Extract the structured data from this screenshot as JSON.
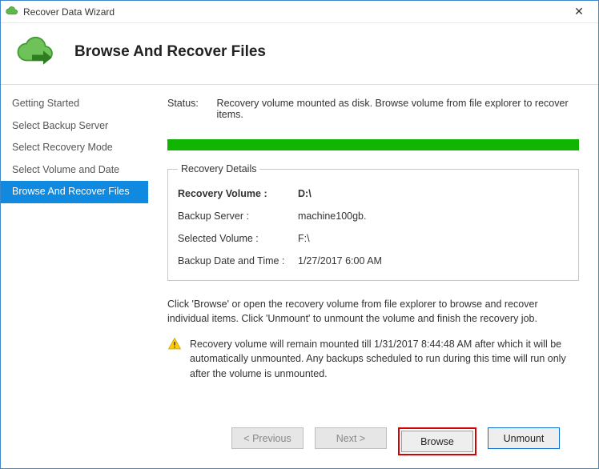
{
  "window": {
    "title": "Recover Data Wizard"
  },
  "header": {
    "title": "Browse And Recover Files"
  },
  "sidebar": {
    "items": [
      {
        "label": "Getting Started"
      },
      {
        "label": "Select Backup Server"
      },
      {
        "label": "Select Recovery Mode"
      },
      {
        "label": "Select Volume and Date"
      },
      {
        "label": "Browse And Recover Files"
      }
    ],
    "active_index": 4
  },
  "main": {
    "status_label": "Status:",
    "status_text": "Recovery volume mounted as disk. Browse volume from file explorer to recover items.",
    "details_legend": "Recovery Details",
    "details": {
      "recovery_volume_label": "Recovery Volume :",
      "recovery_volume_value": "D:\\",
      "backup_server_label": "Backup Server :",
      "backup_server_value": "machine100gb.",
      "selected_volume_label": "Selected Volume :",
      "selected_volume_value": "F:\\",
      "backup_datetime_label": "Backup Date and Time :",
      "backup_datetime_value": "1/27/2017 6:00 AM"
    },
    "instruction_text": "Click 'Browse' or open the recovery volume from file explorer to browse and recover individual items. Click 'Unmount' to unmount the volume and finish the recovery job.",
    "warning_text": "Recovery volume will remain mounted till 1/31/2017 8:44:48 AM after which it will be automatically unmounted. Any backups scheduled to run during this time will run only after the volume is unmounted."
  },
  "footer": {
    "previous_label": "< Previous",
    "next_label": "Next >",
    "browse_label": "Browse",
    "unmount_label": "Unmount"
  }
}
